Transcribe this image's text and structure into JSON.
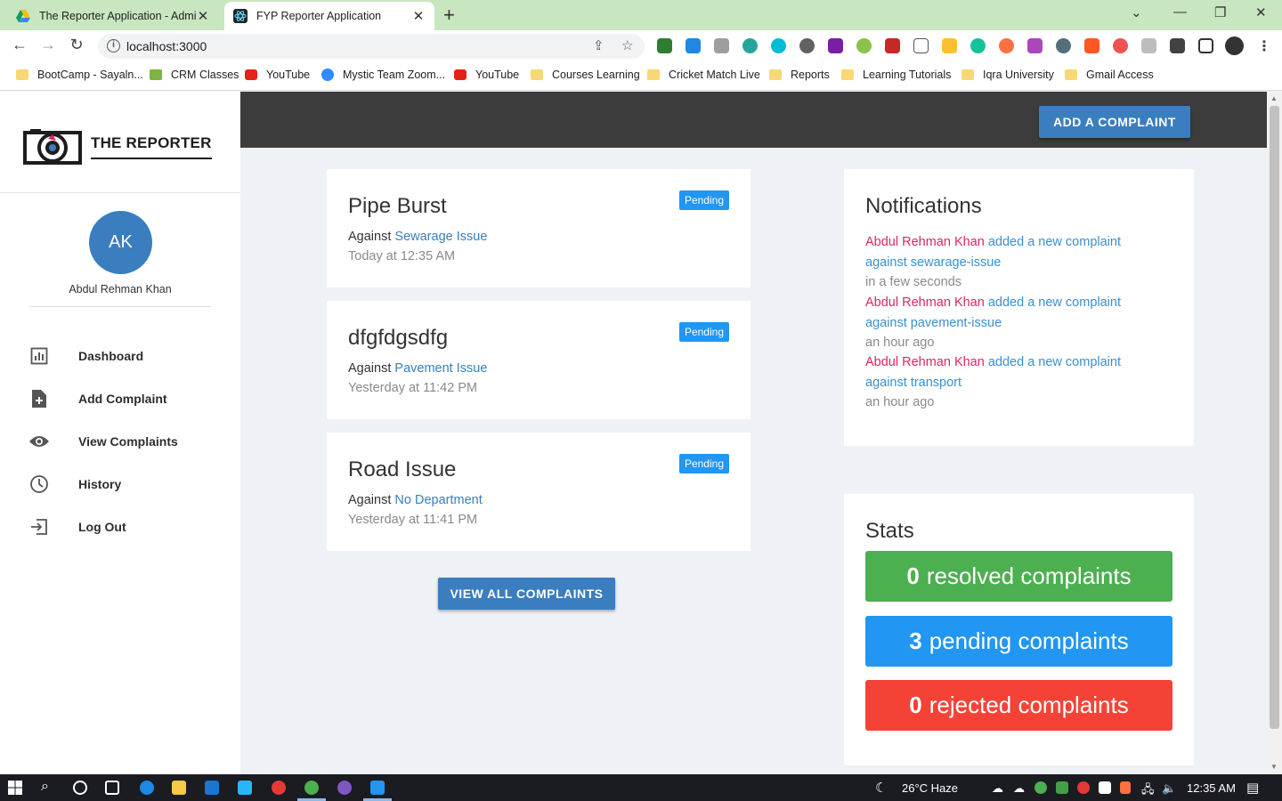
{
  "browser": {
    "tabs": [
      {
        "title": "The Reporter Application - Admi",
        "active": false
      },
      {
        "title": "FYP Reporter Application",
        "active": true
      }
    ],
    "url": "localhost:3000",
    "bookmarks": [
      {
        "label": "BootCamp  - Sayaln...",
        "icon": "folder"
      },
      {
        "label": "CRM Classes",
        "icon": "crm"
      },
      {
        "label": "YouTube",
        "icon": "yt"
      },
      {
        "label": "Mystic Team Zoom...",
        "icon": "zoom"
      },
      {
        "label": "YouTube",
        "icon": "yt"
      },
      {
        "label": "Courses Learning",
        "icon": "folder"
      },
      {
        "label": "Cricket Match Live",
        "icon": "folder"
      },
      {
        "label": "Reports",
        "icon": "folder"
      },
      {
        "label": "Learning Tutorials",
        "icon": "folder"
      },
      {
        "label": "Iqra University",
        "icon": "folder"
      },
      {
        "label": "Gmail Access",
        "icon": "folder"
      }
    ]
  },
  "sidebar": {
    "logo_text": "THE REPORTER",
    "avatar_initials": "AK",
    "user_name": "Abdul Rehman Khan",
    "items": [
      {
        "label": "Dashboard",
        "icon": "chart-icon"
      },
      {
        "label": "Add Complaint",
        "icon": "file-plus-icon"
      },
      {
        "label": "View Complaints",
        "icon": "eye-icon"
      },
      {
        "label": "History",
        "icon": "clock-icon"
      },
      {
        "label": "Log Out",
        "icon": "logout-icon"
      }
    ]
  },
  "header": {
    "add_button": "ADD A COMPLAINT"
  },
  "complaints": [
    {
      "title": "Pipe Burst",
      "status": "Pending",
      "against_label": "Against",
      "department": "Sewarage Issue",
      "time": "Today at 12:35 AM"
    },
    {
      "title": "dfgfdgsdfg",
      "status": "Pending",
      "against_label": "Against",
      "department": "Pavement Issue",
      "time": "Yesterday at 11:42 PM"
    },
    {
      "title": "Road Issue",
      "status": "Pending",
      "against_label": "Against",
      "department": "No Department",
      "time": "Yesterday at 11:41 PM"
    }
  ],
  "view_all_button": "VIEW ALL COMPLAINTS",
  "notifications": {
    "title": "Notifications",
    "items": [
      {
        "who": "Abdul Rehman Khan",
        "action": "added a new complaint against sewarage-issue",
        "when": "in a few seconds"
      },
      {
        "who": "Abdul Rehman Khan",
        "action": "added a new complaint against pavement-issue",
        "when": "an hour ago"
      },
      {
        "who": "Abdul Rehman Khan",
        "action": "added a new complaint against transport",
        "when": "an hour ago"
      }
    ]
  },
  "stats": {
    "title": "Stats",
    "items": [
      {
        "count": "0",
        "label": "resolved complaints",
        "color": "#4caf50"
      },
      {
        "count": "3",
        "label": "pending complaints",
        "color": "#2196f3"
      },
      {
        "count": "0",
        "label": "rejected complaints",
        "color": "#f44336"
      }
    ]
  },
  "taskbar": {
    "weather": "26°C  Haze",
    "time": "12:35 AM"
  },
  "colors": {
    "primary": "#3a7ebf",
    "badge": "#2196f3",
    "notif_name": "#e0245e",
    "notif_action": "#3a8fcf"
  }
}
